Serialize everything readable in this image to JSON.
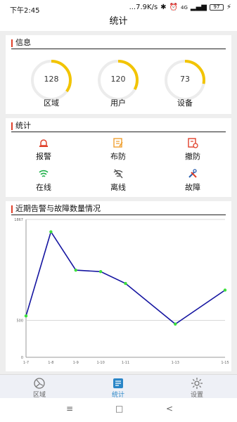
{
  "status": {
    "time": "下午2:45",
    "speed": "...7.9K/s",
    "network": "4G",
    "battery": "97"
  },
  "header": {
    "title": "统计"
  },
  "info": {
    "title": "信息",
    "gauges": [
      {
        "value": "128",
        "label": "区域",
        "fill": 0.35
      },
      {
        "value": "120",
        "label": "用户",
        "fill": 0.33
      },
      {
        "value": "73",
        "label": "设备",
        "fill": 0.28
      }
    ]
  },
  "stats": {
    "title": "统计",
    "actions": [
      {
        "label": "报警",
        "icon": "alarm-icon",
        "color": "#e0402a"
      },
      {
        "label": "布防",
        "icon": "arm-icon",
        "color": "#f0a030"
      },
      {
        "label": "撤防",
        "icon": "disarm-icon",
        "color": "#e0402a"
      },
      {
        "label": "在线",
        "icon": "wifi-icon",
        "color": "#22b14c"
      },
      {
        "label": "离线",
        "icon": "wifi-off-icon",
        "color": "#555555"
      },
      {
        "label": "故障",
        "icon": "tools-icon",
        "color": "#e0402a"
      }
    ]
  },
  "trend": {
    "title": "近期告警与故障数量情况"
  },
  "chart_data": {
    "type": "line",
    "categories": [
      "1-7",
      "1-8",
      "1-9",
      "1-10",
      "1-11",
      "1-13",
      "1-15"
    ],
    "x": [
      7,
      8,
      9,
      10,
      11,
      13,
      15
    ],
    "values": [
      560,
      1700,
      1180,
      1160,
      1000,
      450,
      910
    ],
    "yticks": [
      "0",
      "500",
      "1867"
    ],
    "ylim": [
      0,
      1867
    ],
    "line_color": "#1414a0",
    "point_color": "#3ce03c"
  },
  "tabs": [
    {
      "label": "区域",
      "icon": "region-icon",
      "active": false
    },
    {
      "label": "统计",
      "icon": "stats-icon",
      "active": true
    },
    {
      "label": "设置",
      "icon": "gear-icon",
      "active": false
    }
  ],
  "nav": {
    "menu": "≡",
    "home": "□",
    "back": "<"
  }
}
